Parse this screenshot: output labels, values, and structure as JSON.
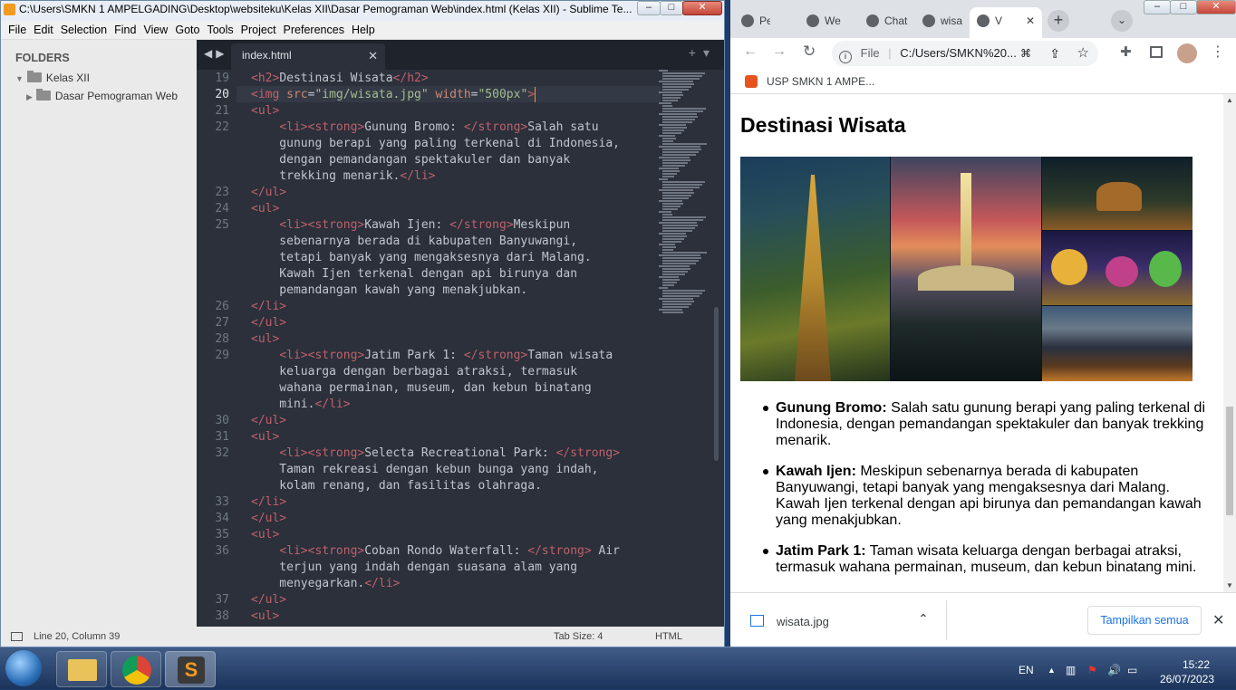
{
  "sublime": {
    "title": "C:\\Users\\SMKN 1 AMPELGADING\\Desktop\\websiteku\\Kelas XII\\Dasar Pemograman Web\\index.html (Kelas XII) - Sublime Te...",
    "menu": [
      "File",
      "Edit",
      "Selection",
      "Find",
      "View",
      "Goto",
      "Tools",
      "Project",
      "Preferences",
      "Help"
    ],
    "sidebar": {
      "header": "FOLDERS",
      "root": "Kelas XII",
      "child": "Dasar Pemograman Web"
    },
    "tab": {
      "label": "index.html"
    },
    "status": {
      "position": "Line 20, Column 39",
      "tab_size": "Tab Size: 4",
      "syntax": "HTML"
    },
    "line_numbers": [
      "19",
      "20",
      "21",
      "22",
      "",
      "",
      "",
      "23",
      "24",
      "25",
      "",
      "",
      "",
      "",
      "26",
      "27",
      "28",
      "29",
      "",
      "",
      "",
      "30",
      "31",
      "32",
      "",
      "",
      "33",
      "34",
      "35",
      "36",
      "",
      "",
      "37",
      "38"
    ],
    "code": [
      [
        [
          "tg",
          "<h2>"
        ],
        [
          "pu",
          "Destinasi Wisata"
        ],
        [
          "tg",
          "</h2>"
        ]
      ],
      [
        [
          "tg",
          "<img "
        ],
        [
          "at",
          "src"
        ],
        [
          "pu",
          "="
        ],
        [
          "st",
          "\"img/wisata.jpg\""
        ],
        [
          "pu",
          " "
        ],
        [
          "at",
          "width"
        ],
        [
          "pu",
          "="
        ],
        [
          "st",
          "\"500px\""
        ],
        [
          "tg",
          ">"
        ]
      ],
      [
        [
          "tg",
          "<ul>"
        ]
      ],
      [
        [
          "pu",
          "    "
        ],
        [
          "tg",
          "<li><strong>"
        ],
        [
          "pu",
          "Gunung Bromo: "
        ],
        [
          "tg",
          "</strong>"
        ],
        [
          "pu",
          "Salah satu"
        ]
      ],
      [
        [
          "pu",
          "    gunung berapi yang paling terkenal di Indonesia,"
        ]
      ],
      [
        [
          "pu",
          "    dengan pemandangan spektakuler dan banyak"
        ]
      ],
      [
        [
          "pu",
          "    trekking menarik."
        ],
        [
          "tg",
          "</li>"
        ]
      ],
      [
        [
          "tg",
          "</ul>"
        ]
      ],
      [
        [
          "tg",
          "<ul>"
        ]
      ],
      [
        [
          "pu",
          "    "
        ],
        [
          "tg",
          "<li><strong>"
        ],
        [
          "pu",
          "Kawah Ijen: "
        ],
        [
          "tg",
          "</strong>"
        ],
        [
          "pu",
          "Meskipun"
        ]
      ],
      [
        [
          "pu",
          "    sebenarnya berada di kabupaten Banyuwangi,"
        ]
      ],
      [
        [
          "pu",
          "    tetapi banyak yang mengaksesnya dari Malang."
        ]
      ],
      [
        [
          "pu",
          "    Kawah Ijen terkenal dengan api birunya dan"
        ]
      ],
      [
        [
          "pu",
          "    pemandangan kawah yang menakjubkan."
        ]
      ],
      [
        [
          "tg",
          "</li>"
        ]
      ],
      [
        [
          "tg",
          "</ul>"
        ]
      ],
      [
        [
          "tg",
          "<ul>"
        ]
      ],
      [
        [
          "pu",
          "    "
        ],
        [
          "tg",
          "<li><strong>"
        ],
        [
          "pu",
          "Jatim Park 1: "
        ],
        [
          "tg",
          "</strong>"
        ],
        [
          "pu",
          "Taman wisata"
        ]
      ],
      [
        [
          "pu",
          "    keluarga dengan berbagai atraksi, termasuk"
        ]
      ],
      [
        [
          "pu",
          "    wahana permainan, museum, dan kebun binatang"
        ]
      ],
      [
        [
          "pu",
          "    mini."
        ],
        [
          "tg",
          "</li>"
        ]
      ],
      [
        [
          "tg",
          "</ul>"
        ]
      ],
      [
        [
          "tg",
          "<ul>"
        ]
      ],
      [
        [
          "pu",
          "    "
        ],
        [
          "tg",
          "<li><strong>"
        ],
        [
          "pu",
          "Selecta Recreational Park: "
        ],
        [
          "tg",
          "</strong>"
        ]
      ],
      [
        [
          "pu",
          "    Taman rekreasi dengan kebun bunga yang indah,"
        ]
      ],
      [
        [
          "pu",
          "    kolam renang, dan fasilitas olahraga."
        ]
      ],
      [
        [
          "tg",
          "</li>"
        ]
      ],
      [
        [
          "tg",
          "</ul>"
        ]
      ],
      [
        [
          "tg",
          "<ul>"
        ]
      ],
      [
        [
          "pu",
          "    "
        ],
        [
          "tg",
          "<li><strong>"
        ],
        [
          "pu",
          "Coban Rondo Waterfall: "
        ],
        [
          "tg",
          "</strong>"
        ],
        [
          "pu",
          " Air"
        ]
      ],
      [
        [
          "pu",
          "    terjun yang indah dengan suasana alam yang"
        ]
      ],
      [
        [
          "pu",
          "    menyegarkan."
        ],
        [
          "tg",
          "</li>"
        ]
      ],
      [
        [
          "tg",
          "</ul>"
        ]
      ],
      [
        [
          "tg",
          "<ul>"
        ]
      ]
    ]
  },
  "chrome": {
    "tabs": [
      "Pers",
      "Web",
      "Chat",
      "wisa",
      "V"
    ],
    "url_prefix": "File",
    "url": "C:/Users/SMKN%20...",
    "bookmark": "USP SMKN 1 AMPE...",
    "page": {
      "heading": "Destinasi Wisata",
      "items": [
        {
          "bold": "Gunung Bromo:",
          "text": " Salah satu gunung berapi yang paling terkenal di Indonesia, dengan pemandangan spektakuler dan banyak trekking menarik."
        },
        {
          "bold": "Kawah Ijen:",
          "text": " Meskipun sebenarnya berada di kabupaten Banyuwangi, tetapi banyak yang mengaksesnya dari Malang. Kawah Ijen terkenal dengan api birunya dan pemandangan kawah yang menakjubkan."
        },
        {
          "bold": "Jatim Park 1:",
          "text": " Taman wisata keluarga dengan berbagai atraksi, termasuk wahana permainan, museum, dan kebun binatang mini."
        }
      ]
    },
    "download": {
      "file": "wisata.jpg",
      "show_all": "Tampilkan semua"
    }
  },
  "taskbar": {
    "lang": "EN",
    "time": "15:22",
    "date": "26/07/2023"
  }
}
